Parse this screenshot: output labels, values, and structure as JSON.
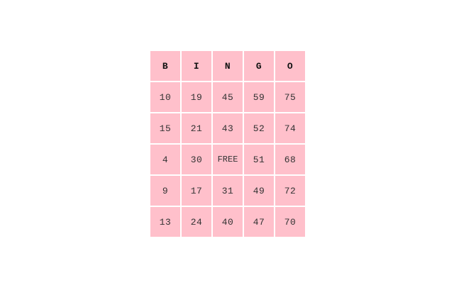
{
  "bingo": {
    "headers": [
      "B",
      "I",
      "N",
      "G",
      "O"
    ],
    "rows": [
      [
        "10",
        "19",
        "45",
        "59",
        "75"
      ],
      [
        "15",
        "21",
        "43",
        "52",
        "74"
      ],
      [
        "4",
        "30",
        "FREE",
        "51",
        "68"
      ],
      [
        "9",
        "17",
        "31",
        "49",
        "72"
      ],
      [
        "13",
        "24",
        "40",
        "47",
        "70"
      ]
    ]
  },
  "colors": {
    "cell_background": "#ffc0cb",
    "page_background": "#ffffff"
  }
}
